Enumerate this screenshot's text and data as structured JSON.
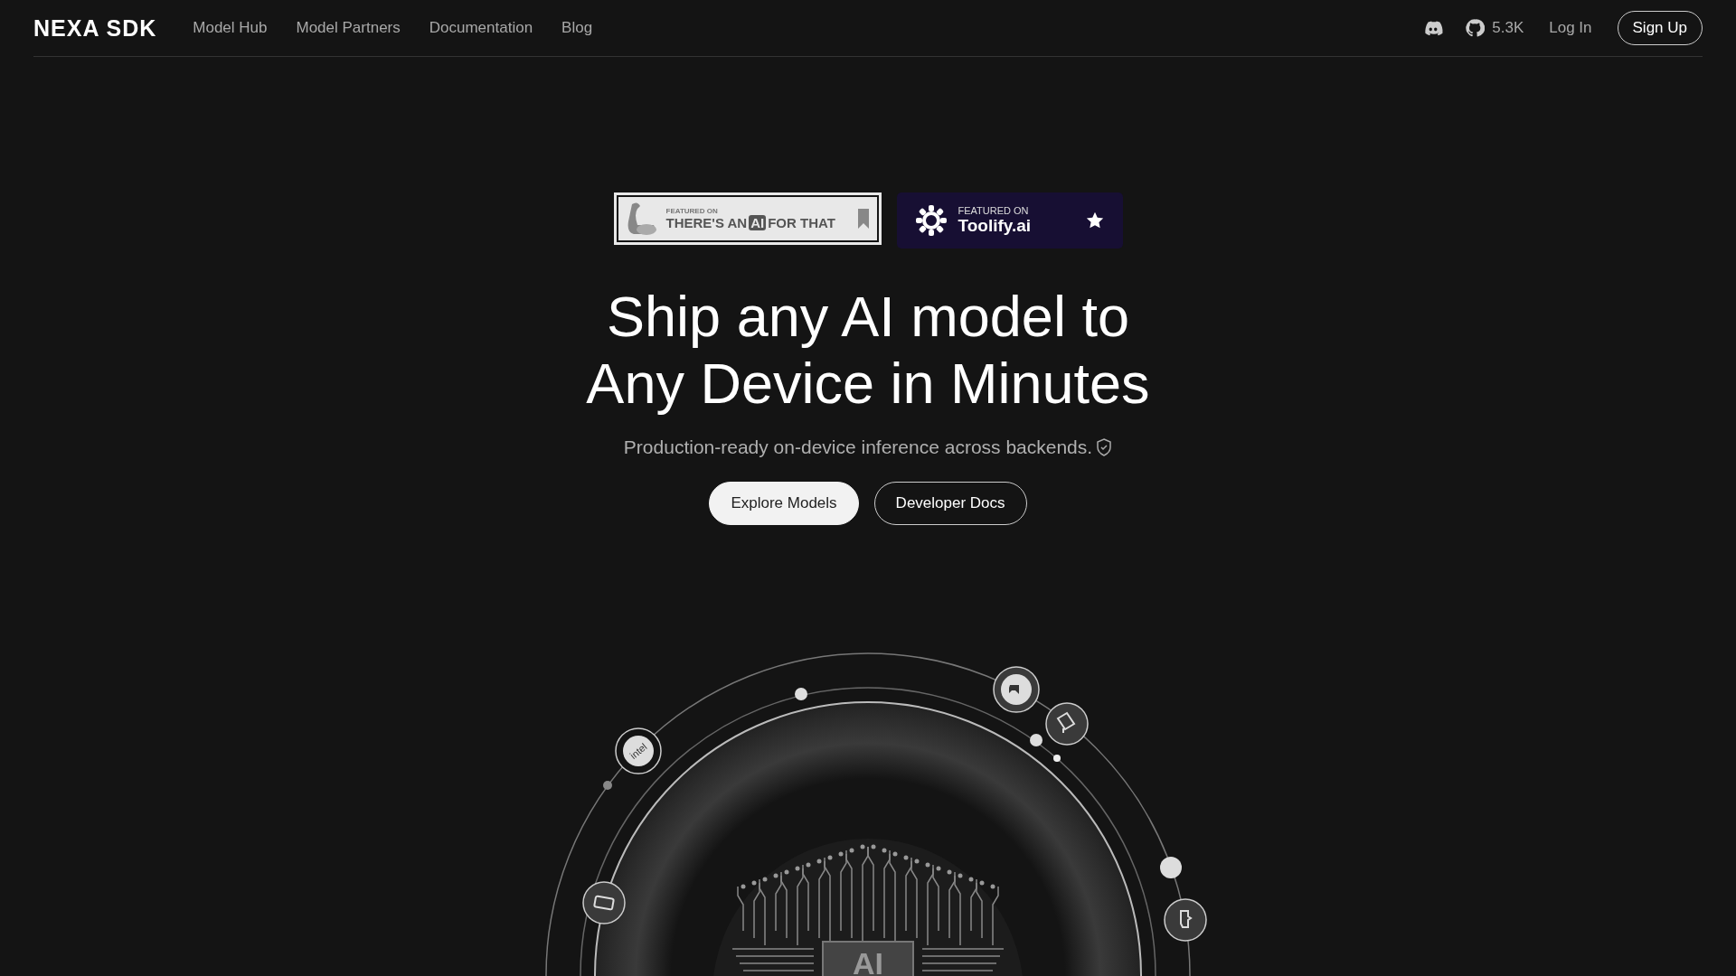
{
  "header": {
    "logo": "NEXA SDK",
    "nav": [
      {
        "label": "Model Hub"
      },
      {
        "label": "Model Partners"
      },
      {
        "label": "Documentation"
      },
      {
        "label": "Blog"
      }
    ],
    "github_stars": "5.3K",
    "login": "Log In",
    "signup": "Sign Up"
  },
  "badges": [
    {
      "kind": "taaft",
      "caption": "FEATURED ON",
      "name_before": "THERE'S AN",
      "name_mark": "AI",
      "name_after": "FOR THAT"
    },
    {
      "kind": "toolify",
      "caption": "FEATURED ON",
      "name": "Toolify.ai"
    }
  ],
  "hero": {
    "title_lines": [
      "Ship any AI model to",
      "Any Device in Minutes"
    ],
    "subtitle": "Production-ready on-device inference across backends.",
    "buttons": [
      {
        "label": "Explore Models",
        "kind": "primary"
      },
      {
        "label": "Developer Docs",
        "kind": "secondary"
      }
    ]
  },
  "diagram": {
    "intel_label": "intel",
    "chip_label": "AI"
  }
}
